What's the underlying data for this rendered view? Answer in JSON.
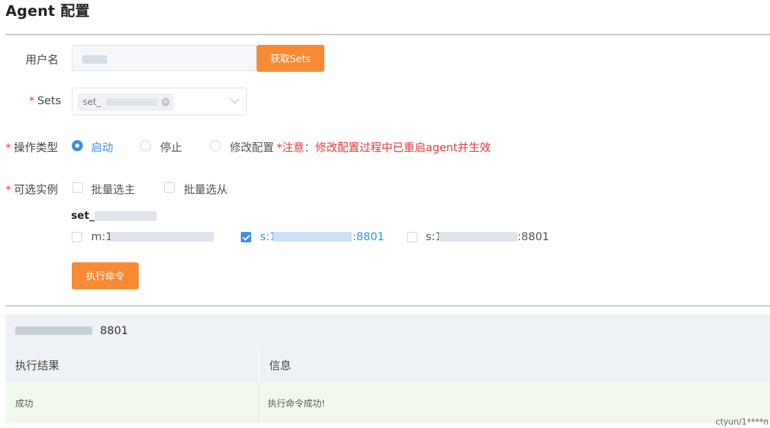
{
  "page": {
    "title": "Agent 配置"
  },
  "form": {
    "username": {
      "label": "用户名",
      "value": "",
      "fetch_button": "获取Sets"
    },
    "sets": {
      "required_mark": "*",
      "label": "Sets",
      "selected_tag": "set_"
    },
    "operation": {
      "required_mark": "*",
      "label": "操作类型",
      "options": [
        {
          "label": "启动",
          "checked": true
        },
        {
          "label": "停止",
          "checked": false
        },
        {
          "label": "修改配置",
          "checked": false
        }
      ],
      "warning": "*注意：修改配置过程中已重启agent并生效"
    },
    "instances": {
      "required_mark": "*",
      "label": "可选实例",
      "batch_options": [
        {
          "label": "批量选主",
          "checked": false
        },
        {
          "label": "批量选从",
          "checked": false
        }
      ],
      "set_name": "set_",
      "items": [
        {
          "label": "m:1",
          "checked": false
        },
        {
          "label": "s:1",
          "port_suffix": ":8801",
          "checked": true
        },
        {
          "label": "s:1",
          "port_suffix": ":8801",
          "checked": false
        }
      ]
    },
    "execute_button": "执行命令"
  },
  "result": {
    "host_suffix": "8801",
    "columns": [
      "执行结果",
      "信息"
    ],
    "rows": [
      {
        "status": "成功",
        "message": "执行命令成功!"
      }
    ]
  },
  "watermark": "ctyun/1****n",
  "colors": {
    "accent": "#3a8ee6",
    "button": "#f98a34",
    "error": "#e4393c",
    "success_row": "#f0f9eb"
  }
}
